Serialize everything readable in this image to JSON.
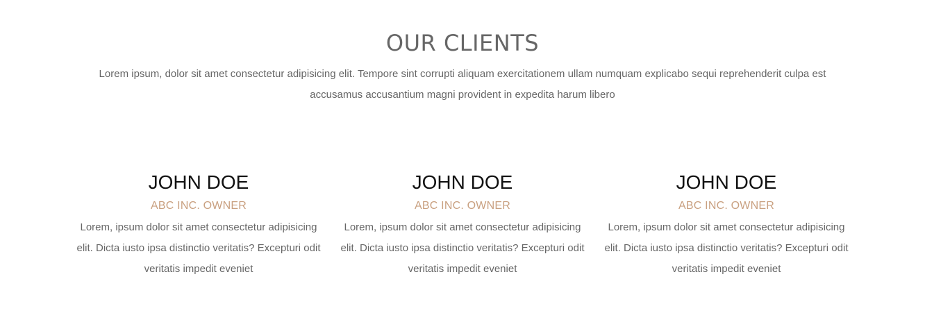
{
  "section": {
    "title": "OUR CLIENTS",
    "intro": "Lorem ipsum, dolor sit amet consectetur adipisicing elit. Tempore sint corrupti aliquam exercitationem ullam numquam explicabo sequi reprehenderit culpa est accusamus accusantium magni provident in expedita harum libero"
  },
  "clients": [
    {
      "name": "JOHN DOE",
      "role": "ABC INC. OWNER",
      "text": "Lorem, ipsum dolor sit amet consectetur adipisicing elit. Dicta iusto ipsa distinctio veritatis? Excepturi odit veritatis impedit eveniet"
    },
    {
      "name": "JOHN DOE",
      "role": "ABC INC. OWNER",
      "text": "Lorem, ipsum dolor sit amet consectetur adipisicing elit. Dicta iusto ipsa distinctio veritatis? Excepturi odit veritatis impedit eveniet"
    },
    {
      "name": "JOHN DOE",
      "role": "ABC INC. OWNER",
      "text": "Lorem, ipsum dolor sit amet consectetur adipisicing elit. Dicta iusto ipsa distinctio veritatis? Excepturi odit veritatis impedit eveniet"
    }
  ],
  "colors": {
    "heading": "#666666",
    "role_accent": "#c9a080",
    "name": "#111111",
    "body_text": "#666666",
    "background": "#ffffff"
  }
}
